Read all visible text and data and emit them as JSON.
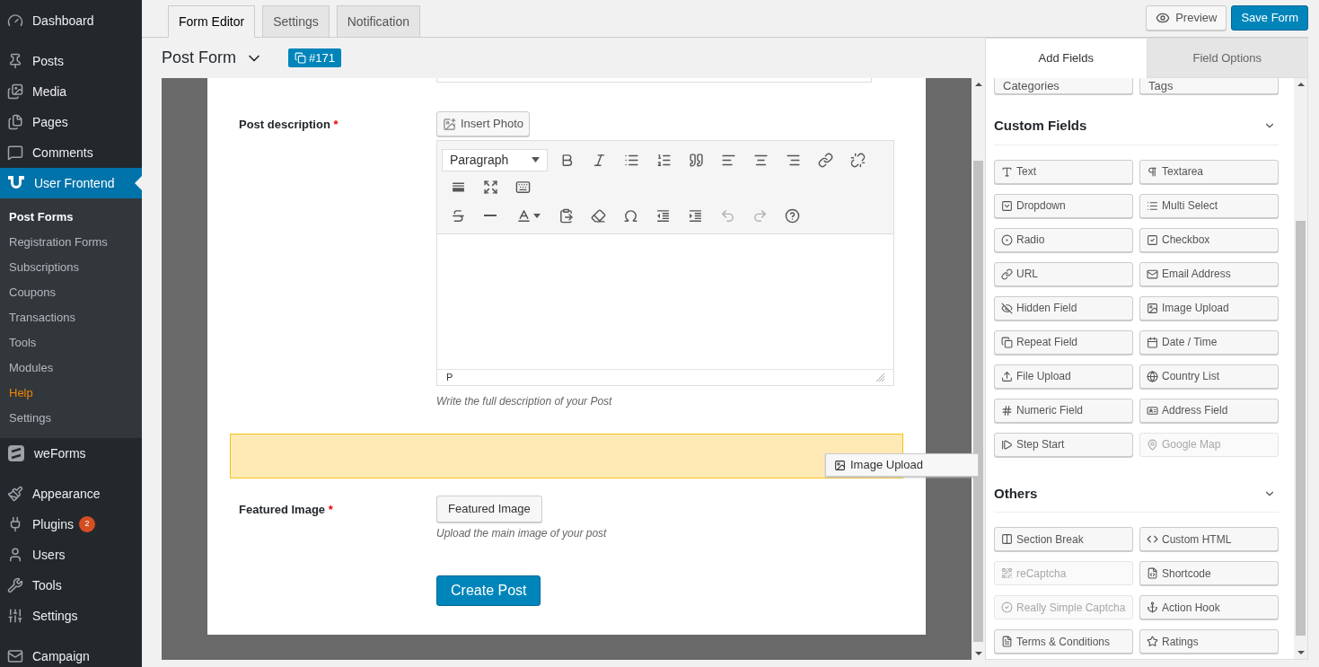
{
  "sidebar": {
    "groups": [
      [
        {
          "label": "Dashboard",
          "selected": false
        }
      ],
      [
        {
          "label": "Posts",
          "selected": false
        },
        {
          "label": "Media",
          "selected": false
        },
        {
          "label": "Pages",
          "selected": false
        },
        {
          "label": "Comments",
          "selected": false
        },
        {
          "label": "User Frontend",
          "selected": true,
          "children": [
            {
              "label": "Post Forms",
              "selected": true,
              "highlighted": false
            },
            {
              "label": "Registration Forms",
              "selected": false,
              "highlighted": false
            },
            {
              "label": "Subscriptions",
              "selected": false,
              "highlighted": false
            },
            {
              "label": "Coupons",
              "selected": false,
              "highlighted": false
            },
            {
              "label": "Transactions",
              "selected": false,
              "highlighted": false
            },
            {
              "label": "Tools",
              "selected": false,
              "highlighted": false
            },
            {
              "label": "Modules",
              "selected": false,
              "highlighted": false
            },
            {
              "label": "Help",
              "selected": false,
              "highlighted": true
            },
            {
              "label": "Settings",
              "selected": false,
              "highlighted": false
            }
          ]
        },
        {
          "label": "weForms",
          "selected": false
        }
      ],
      [
        {
          "label": "Appearance",
          "selected": false
        },
        {
          "label": "Plugins",
          "selected": false,
          "badge": "2"
        },
        {
          "label": "Users",
          "selected": false
        },
        {
          "label": "Tools",
          "selected": false
        },
        {
          "label": "Settings",
          "selected": false
        }
      ],
      [
        {
          "label": "Campaign",
          "selected": false
        }
      ]
    ]
  },
  "tabs": [
    {
      "label": "Form Editor",
      "selected": true
    },
    {
      "label": "Settings",
      "selected": false
    },
    {
      "label": "Notification",
      "selected": false
    }
  ],
  "actions": [
    {
      "label": "Preview",
      "kind": "secondary"
    },
    {
      "label": "Save Form",
      "kind": "primary"
    }
  ],
  "form_header": {
    "title": "Post Form",
    "form_id": "#171"
  },
  "form": {
    "fields": [
      {
        "kind": "cut_input"
      },
      {
        "kind": "editor",
        "label": "Post description",
        "required_mark": "*",
        "button": "Insert Photo",
        "format": "Paragraph",
        "toolbar_rows": [
          [
            {
              "disabled": false
            },
            {
              "disabled": false
            },
            {
              "disabled": false
            },
            {
              "disabled": false
            },
            {
              "disabled": false
            },
            {
              "disabled": false
            },
            {
              "disabled": false
            },
            {
              "disabled": false
            },
            {
              "disabled": false
            },
            {
              "disabled": false
            },
            {
              "disabled": false
            },
            {
              "disabled": false
            },
            {
              "disabled": false
            }
          ],
          [
            {
              "disabled": false
            },
            {
              "disabled": false
            },
            {
              "disabled": false
            },
            {
              "disabled": false
            },
            {
              "disabled": false
            },
            {
              "disabled": false
            },
            {
              "disabled": false
            },
            {
              "disabled": false
            },
            {
              "disabled": true
            },
            {
              "disabled": true
            },
            {
              "disabled": false
            }
          ]
        ],
        "path": "P",
        "help": "Write the full description of your Post"
      },
      {
        "kind": "drop_zone"
      },
      {
        "kind": "file",
        "label": "Featured Image",
        "required_mark": "*",
        "button": "Featured Image",
        "help": "Upload the main image of your post"
      },
      {
        "kind": "submit",
        "button": "Create Post"
      }
    ]
  },
  "drag_helper": {
    "label": "Image Upload"
  },
  "panel": {
    "tabs": [
      {
        "label": "Add Fields",
        "selected": true
      },
      {
        "label": "Field Options",
        "selected": false
      }
    ],
    "cut_buttons": [
      {
        "label": "Categories"
      },
      {
        "label": "Tags"
      }
    ],
    "sections": [
      {
        "title": "Custom Fields",
        "expanded": true,
        "buttons": [
          {
            "label": "Text",
            "disabled": false
          },
          {
            "label": "Textarea",
            "disabled": false
          },
          {
            "label": "Dropdown",
            "disabled": false
          },
          {
            "label": "Multi Select",
            "disabled": false
          },
          {
            "label": "Radio",
            "disabled": false
          },
          {
            "label": "Checkbox",
            "disabled": false
          },
          {
            "label": "URL",
            "disabled": false
          },
          {
            "label": "Email Address",
            "disabled": false
          },
          {
            "label": "Hidden Field",
            "disabled": false
          },
          {
            "label": "Image Upload",
            "disabled": false
          },
          {
            "label": "Repeat Field",
            "disabled": false
          },
          {
            "label": "Date / Time",
            "disabled": false
          },
          {
            "label": "File Upload",
            "disabled": false
          },
          {
            "label": "Country List",
            "disabled": false
          },
          {
            "label": "Numeric Field",
            "disabled": false
          },
          {
            "label": "Address Field",
            "disabled": false
          },
          {
            "label": "Step Start",
            "disabled": false
          },
          {
            "label": "Google Map",
            "disabled": true
          }
        ]
      },
      {
        "title": "Others",
        "expanded": true,
        "buttons": [
          {
            "label": "Section Break",
            "disabled": false
          },
          {
            "label": "Custom HTML",
            "disabled": false
          },
          {
            "label": "reCaptcha",
            "disabled": true
          },
          {
            "label": "Shortcode",
            "disabled": false
          },
          {
            "label": "Really Simple Captcha",
            "disabled": true
          },
          {
            "label": "Action Hook",
            "disabled": false
          },
          {
            "label": "Terms & Conditions",
            "disabled": false
          },
          {
            "label": "Ratings",
            "disabled": false
          }
        ]
      }
    ]
  }
}
